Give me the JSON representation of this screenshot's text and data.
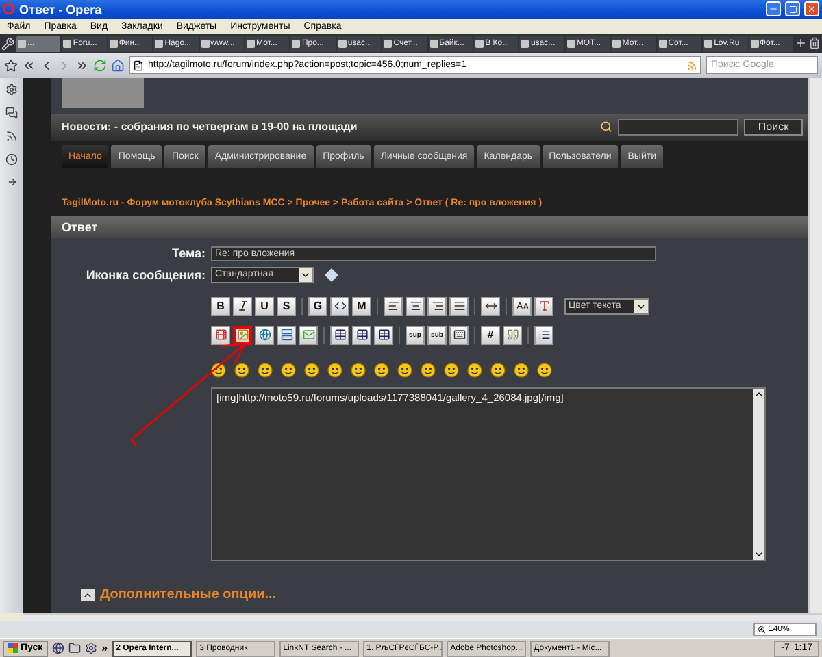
{
  "window": {
    "title": "Ответ - Opera"
  },
  "menu": [
    "Файл",
    "Правка",
    "Вид",
    "Закладки",
    "Виджеты",
    "Инструменты",
    "Справка"
  ],
  "tabs": [
    {
      "label": "...",
      "selected": true
    },
    {
      "label": "Foru...",
      "selected": false
    },
    {
      "label": "Фин...",
      "selected": false
    },
    {
      "label": "Hago...",
      "selected": false
    },
    {
      "label": "www...",
      "selected": false
    },
    {
      "label": "Мот...",
      "selected": false
    },
    {
      "label": "Про...",
      "selected": false
    },
    {
      "label": "usac...",
      "selected": false
    },
    {
      "label": "Счет...",
      "selected": false
    },
    {
      "label": "Байк...",
      "selected": false
    },
    {
      "label": "В Ко...",
      "selected": false
    },
    {
      "label": "usac...",
      "selected": false
    },
    {
      "label": "МОТ...",
      "selected": false
    },
    {
      "label": "Мот...",
      "selected": false
    },
    {
      "label": "Сот...",
      "selected": false
    },
    {
      "label": "Lov.Ru",
      "selected": false
    },
    {
      "label": "Фот...",
      "selected": false
    }
  ],
  "address": {
    "url": "http://tagilmoto.ru/forum/index.php?action=post;topic=456.0;num_replies=1",
    "search_placeholder": "Поиск: Google"
  },
  "forum": {
    "news": "Новости: - собрания по четвергам в 19-00 на площади",
    "search_button": "Поиск",
    "nav": [
      {
        "label": "Начало",
        "selected": true
      },
      {
        "label": "Помощь",
        "selected": false
      },
      {
        "label": "Поиск",
        "selected": false
      },
      {
        "label": "Администрирование",
        "selected": false
      },
      {
        "label": "Профиль",
        "selected": false
      },
      {
        "label": "Личные сообщения",
        "selected": false
      },
      {
        "label": "Календарь",
        "selected": false
      },
      {
        "label": "Пользователи",
        "selected": false
      },
      {
        "label": "Выйти",
        "selected": false
      }
    ],
    "breadcrumb": "TagilMoto.ru - Форум мотоклуба Scythians MCC > Прочее > Работа сайта > Ответ ( Re: про вложения )",
    "panel_title": "Ответ",
    "subject_label": "Тема:",
    "subject": "Re: про вложения",
    "icon_label": "Иконка сообщения:",
    "icon_select": "Стандартная",
    "toolbar_rows": [
      [
        {
          "kind": "letter",
          "label": "B",
          "highlighted": false
        },
        {
          "kind": "icon",
          "highlighted": false
        },
        {
          "kind": "letter",
          "label": "U",
          "highlighted": false
        },
        {
          "kind": "letter",
          "label": "S",
          "highlighted": false
        },
        {
          "kind": "separator"
        },
        {
          "kind": "letter",
          "label": "G",
          "highlighted": false
        },
        {
          "kind": "icon",
          "highlighted": false
        },
        {
          "kind": "letter",
          "label": "M",
          "highlighted": false
        },
        {
          "kind": "separator"
        },
        {
          "kind": "icon",
          "highlighted": false
        },
        {
          "kind": "icon",
          "highlighted": false
        },
        {
          "kind": "icon",
          "highlighted": false
        },
        {
          "kind": "icon",
          "highlighted": false
        },
        {
          "kind": "separator"
        },
        {
          "kind": "icon",
          "highlighted": false
        },
        {
          "kind": "separator"
        },
        {
          "kind": "icon",
          "highlighted": false
        },
        {
          "kind": "icon",
          "highlighted": false
        }
      ],
      [
        {
          "kind": "icon",
          "highlighted": false
        },
        {
          "kind": "icon",
          "highlighted": true
        },
        {
          "kind": "icon",
          "highlighted": false
        },
        {
          "kind": "icon",
          "highlighted": false
        },
        {
          "kind": "icon",
          "highlighted": false
        },
        {
          "kind": "separator"
        },
        {
          "kind": "icon",
          "highlighted": false
        },
        {
          "kind": "icon",
          "highlighted": false
        },
        {
          "kind": "icon",
          "highlighted": false
        },
        {
          "kind": "separator"
        },
        {
          "kind": "letter",
          "label": "sup",
          "highlighted": false
        },
        {
          "kind": "letter",
          "label": "sub",
          "highlighted": false
        },
        {
          "kind": "icon",
          "highlighted": false
        },
        {
          "kind": "separator"
        },
        {
          "kind": "letter",
          "label": "#",
          "highlighted": false
        },
        {
          "kind": "icon",
          "highlighted": false
        },
        {
          "kind": "separator"
        },
        {
          "kind": "icon",
          "highlighted": false
        }
      ]
    ],
    "color_select": "Цвет текста",
    "message": "[img]http://moto59.ru/forums/uploads/1177388041/gallery_4_26084.jpg[/img]",
    "more_options": "Дополнительные опции..."
  },
  "status_bar": {
    "zoom": "140%"
  },
  "taskbar": {
    "start": "Пуск",
    "more": "»",
    "tasks": [
      {
        "label": "2 Opera Intern...",
        "selected": true
      },
      {
        "label": "3 Проводник",
        "selected": false
      },
      {
        "label": "LinkNT Search - ...",
        "selected": false
      },
      {
        "label": "1. РљСЃРєСЃБС-Р...",
        "selected": false
      },
      {
        "label": "Adobe Photoshop...",
        "selected": false
      },
      {
        "label": "Документ1 - Mic...",
        "selected": false
      }
    ],
    "tray_text": "-7",
    "clock": "1:17"
  }
}
